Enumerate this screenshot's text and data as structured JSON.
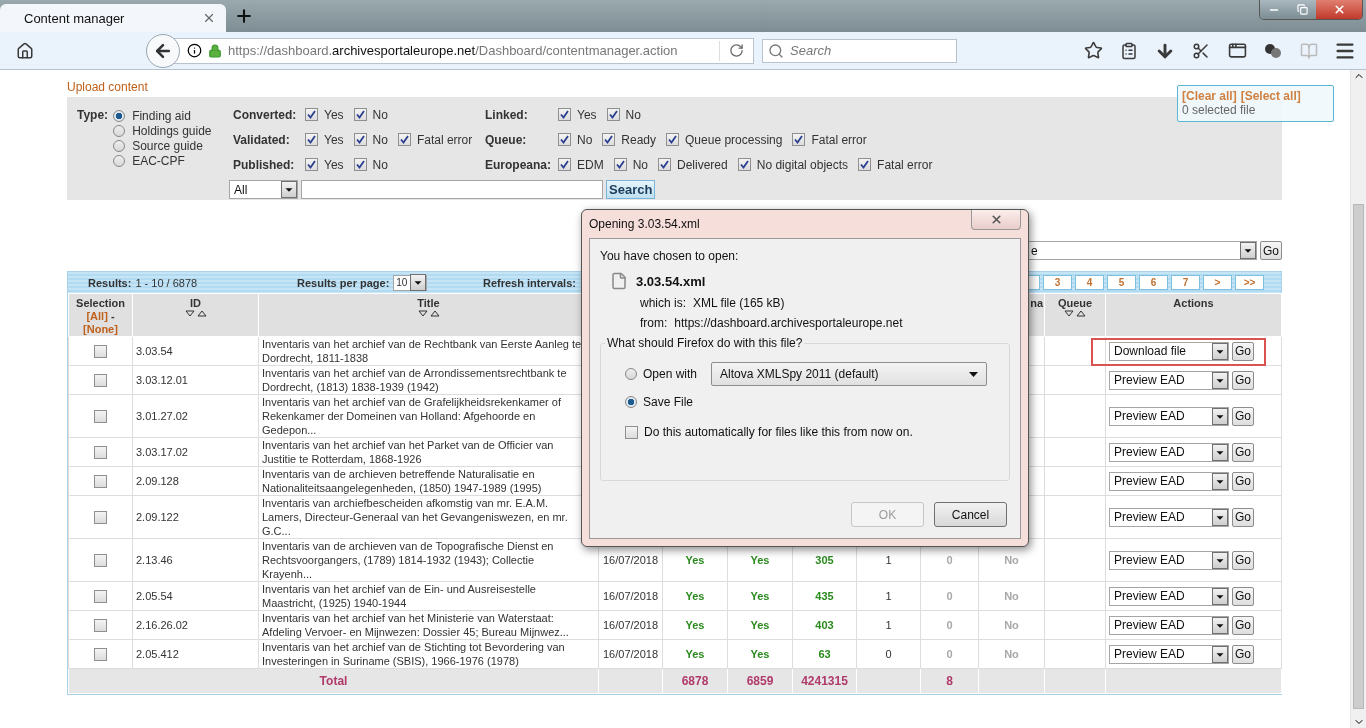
{
  "browser": {
    "tab": {
      "title": "Content manager",
      "selected": true
    },
    "url": {
      "scheme": "https://dashboard.",
      "domain": "archivesportaleurope.net",
      "path": "/Dashboard/contentmanager.action"
    },
    "search": {
      "placeholder": "Search"
    }
  },
  "upload_link": "Upload content",
  "selection_box": {
    "clear": "[Clear all]",
    "select": "[Select all]",
    "count": "0 selected file"
  },
  "filters": {
    "type": {
      "label": "Type:",
      "options": [
        {
          "label": "Finding aid",
          "selected": true
        },
        {
          "label": "Holdings guide",
          "selected": false
        },
        {
          "label": "Source guide",
          "selected": false
        },
        {
          "label": "EAC-CPF",
          "selected": false
        }
      ]
    },
    "columns": [
      {
        "groups": [
          {
            "label": "Converted:",
            "options": [
              {
                "label": "Yes",
                "checked": true
              },
              {
                "label": "No",
                "checked": true
              }
            ]
          },
          {
            "label": "Validated:",
            "options": [
              {
                "label": "Yes",
                "checked": true
              },
              {
                "label": "No",
                "checked": true
              },
              {
                "label": "Fatal error",
                "checked": true
              }
            ]
          },
          {
            "label": "Published:",
            "options": [
              {
                "label": "Yes",
                "checked": true
              },
              {
                "label": "No",
                "checked": true
              }
            ]
          }
        ]
      },
      {
        "groups": [
          {
            "label": "Linked:",
            "options": [
              {
                "label": "Yes",
                "checked": true
              },
              {
                "label": "No",
                "checked": true
              }
            ]
          },
          {
            "label": "Queue:",
            "options": [
              {
                "label": "No",
                "checked": true
              },
              {
                "label": "Ready",
                "checked": true
              },
              {
                "label": "Queue processing",
                "checked": true
              },
              {
                "label": "Fatal error",
                "checked": true
              }
            ]
          },
          {
            "label": "Europeana:",
            "options": [
              {
                "label": "EDM",
                "checked": true
              },
              {
                "label": "No",
                "checked": true
              },
              {
                "label": "Delivered",
                "checked": true
              },
              {
                "label": "No digital objects",
                "checked": true
              },
              {
                "label": "Fatal error",
                "checked": true
              }
            ]
          }
        ]
      }
    ],
    "search": {
      "scope": "All",
      "button": "Search"
    }
  },
  "bulk_action": {
    "value": "e",
    "button": "Go"
  },
  "table": {
    "results_label": "Results:",
    "results": "1 - 10 / 6878",
    "per_page_label": "Results per page:",
    "per_page": "10",
    "refresh_label": "Refresh intervals:",
    "pages": [
      "3",
      "4",
      "5",
      "6",
      "7",
      ">",
      ">>"
    ],
    "columns": [
      {
        "kind": "selection",
        "label": "Selection",
        "links": [
          "[All]",
          "[None]"
        ],
        "separator": "-"
      },
      {
        "kind": "sortable",
        "label": "ID"
      },
      {
        "kind": "sortable",
        "label": "Title"
      },
      {
        "kind": "blank"
      },
      {
        "kind": "blank"
      },
      {
        "kind": "blank"
      },
      {
        "kind": "blank"
      },
      {
        "kind": "blank"
      },
      {
        "kind": "blank"
      },
      {
        "kind": "plain",
        "label": "na"
      },
      {
        "kind": "sortable",
        "label": "Queue"
      },
      {
        "kind": "plain",
        "label": "Actions"
      }
    ],
    "rows": [
      {
        "checked": false,
        "id": "3.03.54",
        "title": "Inventaris van het archief van de Rechtbank van Eerste Aanleg te Dordrecht, 1811-1838",
        "action": "Download file",
        "button": "Go",
        "highlighted": true
      },
      {
        "checked": false,
        "id": "3.03.12.01",
        "title": "Inventaris van het archief van de Arrondissementsrechtbank te Dordrecht, (1813) 1838-1939 (1942)",
        "action": "Preview EAD",
        "button": "Go",
        "highlighted": false
      },
      {
        "checked": false,
        "id": "3.01.27.02",
        "title": "Inventaris van het archief van de Grafelijkheidsrekenkamer of Rekenkamer der Domeinen van Holland: Afgehoorde en Gedepon...",
        "action": "Preview EAD",
        "button": "Go",
        "highlighted": false
      },
      {
        "checked": false,
        "id": "3.03.17.02",
        "title": "Inventaris van het archief van het Parket van de Officier van Justitie te Rotterdam, 1868-1926",
        "action": "Preview EAD",
        "button": "Go",
        "highlighted": false
      },
      {
        "checked": false,
        "id": "2.09.128",
        "title": "Inventaris van de archieven betreffende Naturalisatie en Nationaliteitsaangelegenheden, (1850) 1947-1989 (1995)",
        "action": "Preview EAD",
        "button": "Go",
        "highlighted": false
      },
      {
        "checked": false,
        "id": "2.09.122",
        "title": "Inventaris van archiefbescheiden afkomstig van mr. E.A.M. Lamers, Directeur-Generaal van het Gevangeniswezen, en mr. G.C...",
        "action": "Preview EAD",
        "button": "Go",
        "highlighted": false
      },
      {
        "checked": false,
        "id": "2.13.46",
        "title": "Inventaris van de archieven van de Topografische Dienst en Rechtsvoorgangers, (1789) 1814-1932 (1943); Collectie Krayenh...",
        "column_4": "16/07/2018",
        "column_5": "Yes",
        "column_6": "Yes",
        "column_7": "305",
        "column_8": "1",
        "column_9": "0",
        "column_10": "No",
        "action": "Preview EAD",
        "button": "Go",
        "highlighted": false
      },
      {
        "checked": false,
        "id": "2.05.54",
        "title": "Inventaris van het archief van de Ein- und Ausreisestelle Maastricht, (1925) 1940-1944",
        "column_4": "16/07/2018",
        "column_5": "Yes",
        "column_6": "Yes",
        "column_7": "435",
        "column_8": "1",
        "column_9": "0",
        "column_10": "No",
        "action": "Preview EAD",
        "button": "Go",
        "highlighted": false
      },
      {
        "checked": false,
        "id": "2.16.26.02",
        "title": "Inventaris van het archief van het Ministerie van Waterstaat: Afdeling Vervoer- en Mijnwezen: Dossier 45; Bureau Mijnwez...",
        "column_4": "16/07/2018",
        "column_5": "Yes",
        "column_6": "Yes",
        "column_7": "403",
        "column_8": "1",
        "column_9": "0",
        "column_10": "No",
        "action": "Preview EAD",
        "button": "Go",
        "highlighted": false
      },
      {
        "checked": false,
        "id": "2.05.412",
        "title": "Inventaris van het archief van de Stichting tot Bevordering van Investeringen in Suriname (SBIS), 1966-1976 (1978)",
        "column_4": "16/07/2018",
        "column_5": "Yes",
        "column_6": "Yes",
        "column_7": "63",
        "column_8": "0",
        "column_9": "0",
        "column_10": "No",
        "action": "Preview EAD",
        "button": "Go",
        "highlighted": false
      }
    ],
    "total": {
      "label": "Total",
      "column_5": "6878",
      "column_6": "6859",
      "column_7": "4241315",
      "column_9": "8"
    }
  },
  "dialog": {
    "title": "Opening 3.03.54.xml",
    "intro": "You have chosen to open:",
    "file_name": "3.03.54.xml",
    "details": [
      {
        "label": "which is:",
        "value": "XML file (165 kB)"
      },
      {
        "label": "from:",
        "value": "https://dashboard.archivesportaleurope.net"
      }
    ],
    "question": "What should Firefox do with this file?",
    "choices": [
      {
        "label": "Open with",
        "selected": false,
        "app": "Altova XMLSpy 2011 (default)"
      },
      {
        "label": "Save File",
        "selected": true
      }
    ],
    "remember": {
      "label": "Do this automatically for files like this from now on.",
      "checked": false
    },
    "buttons": [
      {
        "label": "OK",
        "disabled": true
      },
      {
        "label": "Cancel",
        "disabled": false
      }
    ]
  }
}
